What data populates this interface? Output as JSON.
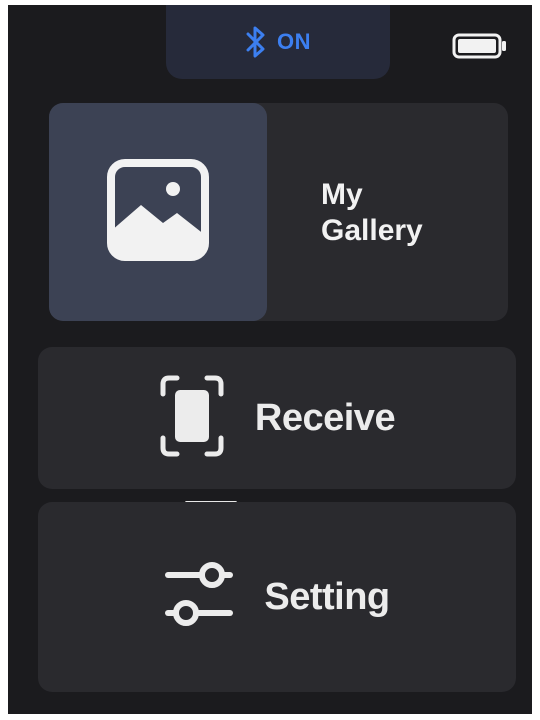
{
  "status": {
    "bluetooth_icon": "bluetooth-icon",
    "bluetooth_state": "ON",
    "accent_color": "#3c7ff0",
    "battery_icon": "battery-icon"
  },
  "menu": {
    "gallery": {
      "label": "My\nGallery",
      "icon": "image-icon"
    },
    "receive": {
      "label": "Receive",
      "icon": "receive-scan-icon"
    },
    "setting": {
      "label": "Setting",
      "icon": "sliders-icon"
    }
  }
}
